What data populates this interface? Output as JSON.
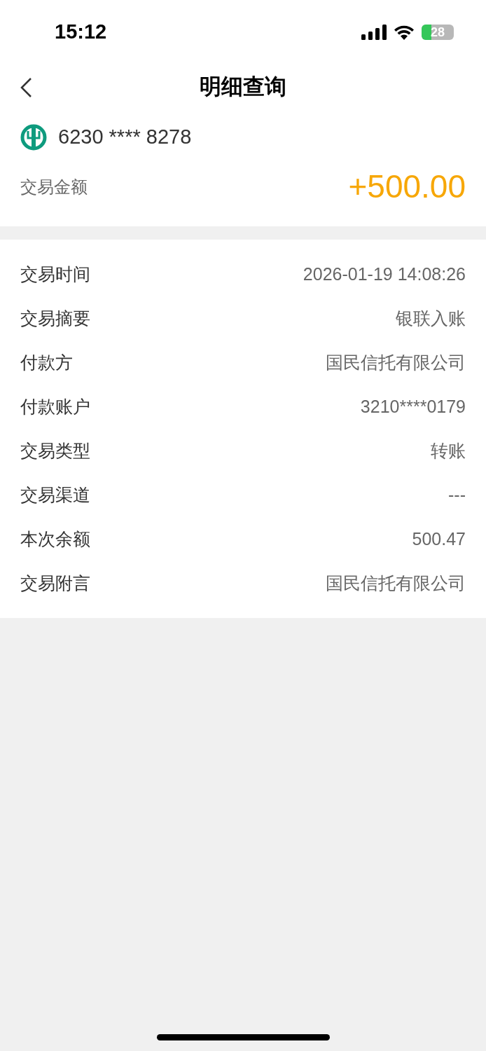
{
  "status_bar": {
    "time": "15:12",
    "battery": "28"
  },
  "header": {
    "title": "明细查询"
  },
  "account": {
    "number": "6230 **** 8278",
    "amount_label": "交易金额",
    "amount": "+500.00"
  },
  "details": [
    {
      "label": "交易时间",
      "value": "2026-01-19 14:08:26"
    },
    {
      "label": "交易摘要",
      "value": "银联入账"
    },
    {
      "label": "付款方",
      "value": "国民信托有限公司"
    },
    {
      "label": "付款账户",
      "value": "3210****0179"
    },
    {
      "label": "交易类型",
      "value": "转账"
    },
    {
      "label": "交易渠道",
      "value": "---"
    },
    {
      "label": "本次余额",
      "value": "500.47"
    },
    {
      "label": "交易附言",
      "value": "国民信托有限公司"
    }
  ]
}
